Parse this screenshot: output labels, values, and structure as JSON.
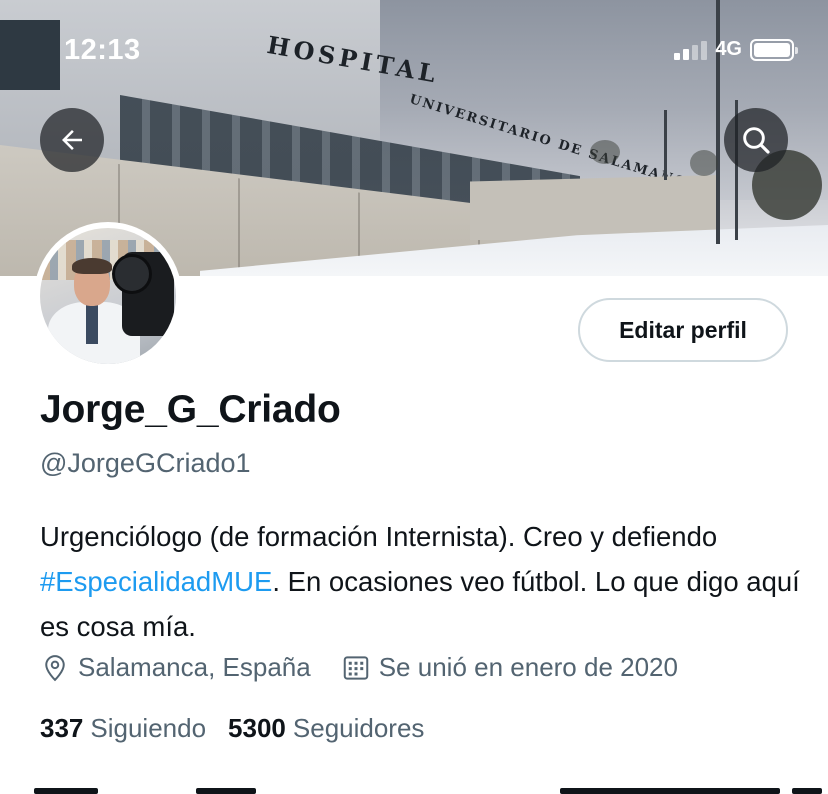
{
  "status_bar": {
    "time": "12:13",
    "network": "4G"
  },
  "banner": {
    "sign_text": "HOSPITAL",
    "sign_text_2": "UNIVERSITARIO DE SALAMANCA"
  },
  "header": {
    "back_icon": "arrow-left-icon",
    "search_icon": "search-icon"
  },
  "profile": {
    "edit_label": "Editar perfil",
    "display_name": "Jorge_G_Criado",
    "handle": "@JorgeGCriado1",
    "bio_part1": "Urgenciólogo (de formación Internista). Creo y defiendo ",
    "bio_hashtag": "#EspecialidadMUE",
    "bio_part2": ". En ocasiones veo fútbol. Lo que digo aquí es cosa mía.",
    "location": "Salamanca, España",
    "joined": "Se unió en enero de 2020",
    "following_count": "337",
    "following_label": "Siguiendo",
    "followers_count": "5300",
    "followers_label": "Seguidores"
  },
  "colors": {
    "accent": "#1d9bf0",
    "text_primary": "#0f1419",
    "text_secondary": "#536471"
  }
}
